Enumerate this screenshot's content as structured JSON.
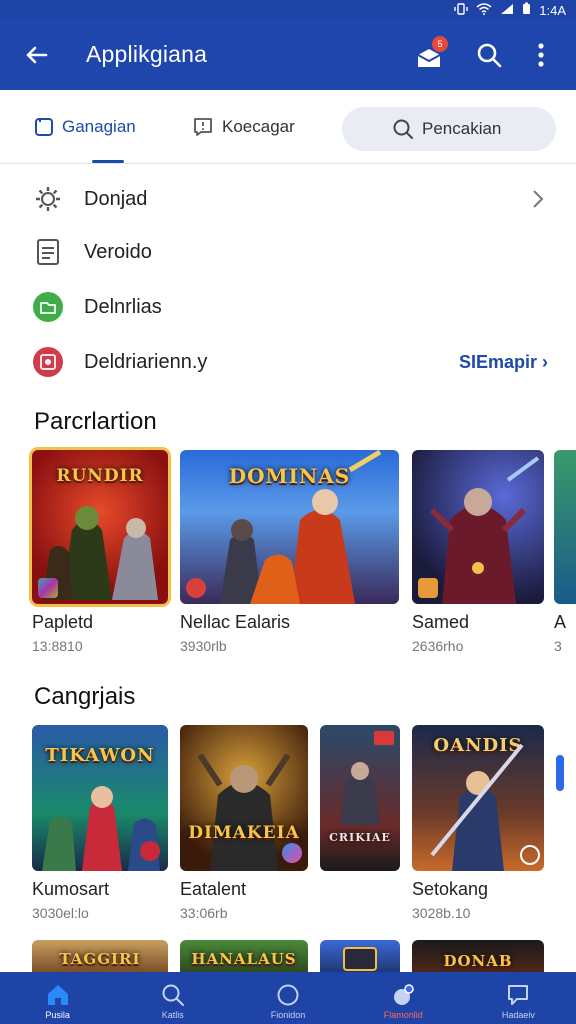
{
  "status_bar": {
    "time": "1:4A"
  },
  "app_bar": {
    "title": "Applikgiana",
    "notification_count": "5"
  },
  "tabs": [
    {
      "label": "Ganagian",
      "active": true
    },
    {
      "label": "Koecagar",
      "active": false
    }
  ],
  "search": {
    "placeholder": "Pencakian"
  },
  "menu": [
    {
      "label": "Donjad",
      "icon": "gear-icon"
    },
    {
      "label": "Veroido",
      "icon": "document-icon"
    },
    {
      "label": "Delnrlias",
      "icon": "folder-icon"
    },
    {
      "label": "Deldriarienn.y",
      "icon": "media-icon",
      "action": "SIEmapir"
    }
  ],
  "section1": {
    "title": "Parcrlartion",
    "cards": [
      {
        "title": "Papletd",
        "sub": "13:8810",
        "art": "RUNDIR"
      },
      {
        "title": "Nellac Ealaris",
        "sub": "3930rlb",
        "art": "DOMINAS"
      },
      {
        "title": "Samed",
        "sub": "2636rho",
        "art": ""
      },
      {
        "title": "A",
        "sub": "3",
        "art": ""
      }
    ]
  },
  "section2": {
    "title": "Cangrjais",
    "cards": [
      {
        "title": "Kumosart",
        "sub": "3030el:lo",
        "art": "TIKAWON"
      },
      {
        "title": "Eatalent",
        "sub": "33:06rb",
        "art": "DIMAKEIA"
      },
      {
        "title": "",
        "sub": "",
        "art": "CRIKIAE"
      },
      {
        "title": "Setokang",
        "sub": "3028b.10",
        "art": "OANDIS"
      }
    ]
  },
  "section3": {
    "cards": [
      {
        "art": "TAGGIRI"
      },
      {
        "art": "HANALAUS"
      },
      {
        "art": ""
      },
      {
        "art": "DONAB"
      }
    ]
  },
  "bottom_nav": [
    {
      "label": "Pusila",
      "icon": "home-icon",
      "active": true
    },
    {
      "label": "Katlis",
      "icon": "search-icon",
      "active": false
    },
    {
      "label": "Fionidon",
      "icon": "circle-icon",
      "active": false
    },
    {
      "label": "Flamonlid",
      "icon": "notification-icon",
      "active": false
    },
    {
      "label": "Hadaeiv",
      "icon": "chat-icon",
      "active": false
    }
  ],
  "colors": {
    "primary": "#1e46ac",
    "accent_text": "#1e4aa8",
    "badge": "#e84a3a"
  }
}
